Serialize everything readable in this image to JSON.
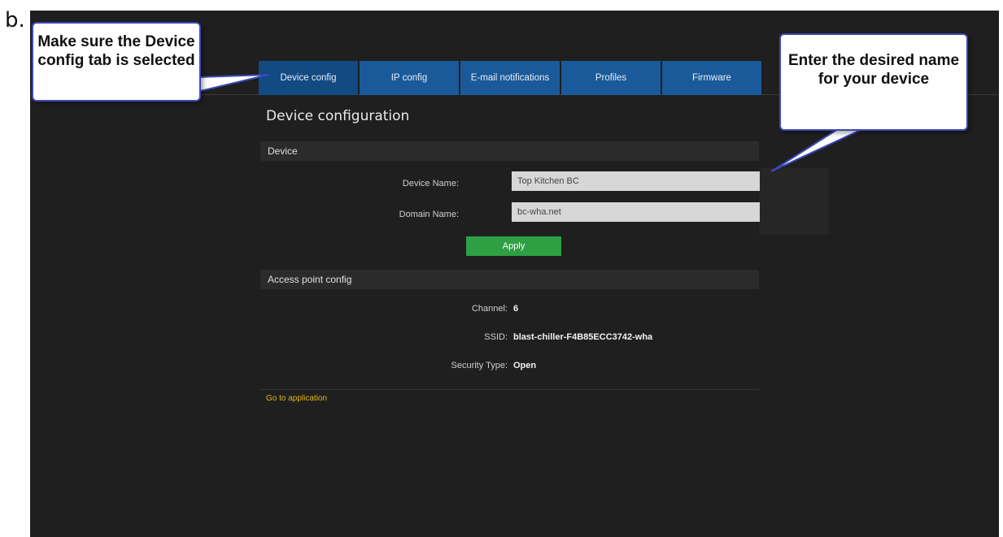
{
  "figure_label": "b.",
  "tabs": [
    {
      "label": "Device config",
      "active": true
    },
    {
      "label": "IP config",
      "active": false
    },
    {
      "label": "E-mail notifications",
      "active": false
    },
    {
      "label": "Profiles",
      "active": false
    },
    {
      "label": "Firmware",
      "active": false
    }
  ],
  "page_title": "Device configuration",
  "device_section": {
    "title": "Device",
    "device_name_label": "Device Name:",
    "device_name_value": "Top Kitchen BC",
    "domain_name_label": "Domain Name:",
    "domain_name_value": "bc-wha.net",
    "apply_label": "Apply"
  },
  "access_point_section": {
    "title": "Access point config",
    "channel_label": "Channel:",
    "channel_value": "6",
    "ssid_label": "SSID:",
    "ssid_value": "blast-chiller-F4B85ECC3742-wha",
    "security_label": "Security Type:",
    "security_value": "Open"
  },
  "go_to_application": "Go to application",
  "callouts": {
    "left_text": "Make sure the Device config tab is selected",
    "right_text": "Enter the desired name for your device"
  },
  "colors": {
    "screen_bg": "#1f1f1f",
    "tab_bg": "#1a5a9a",
    "apply_bg": "#2ea043",
    "link": "#e2b714",
    "callout_border": "#3a48b8"
  }
}
